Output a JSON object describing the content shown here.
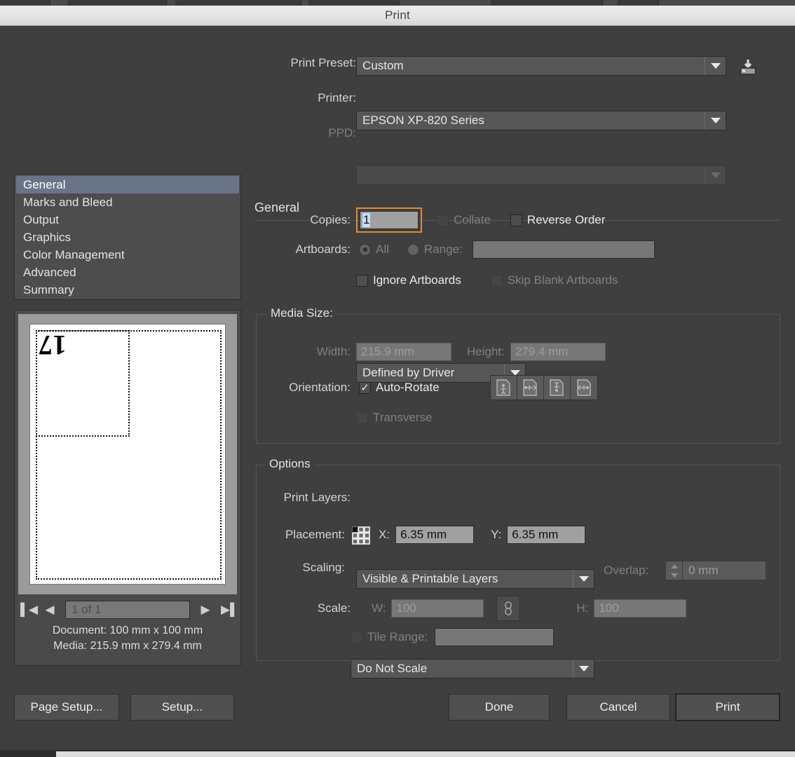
{
  "window": {
    "title": "Print"
  },
  "top_form": {
    "print_preset": {
      "label": "Print Preset:",
      "value": "Custom"
    },
    "printer": {
      "label": "Printer:",
      "value": "EPSON XP-820 Series"
    },
    "ppd": {
      "label": "PPD:",
      "value": ""
    },
    "save_preset_icon": "save-preset-icon"
  },
  "sidebar": {
    "items": [
      {
        "label": "General",
        "selected": true
      },
      {
        "label": "Marks and Bleed",
        "selected": false
      },
      {
        "label": "Output",
        "selected": false
      },
      {
        "label": "Graphics",
        "selected": false
      },
      {
        "label": "Color Management",
        "selected": false
      },
      {
        "label": "Advanced",
        "selected": false
      },
      {
        "label": "Summary",
        "selected": false
      }
    ]
  },
  "preview": {
    "artwork_glyph": "17",
    "page_indicator": "1 of 1",
    "document_line": "Document: 100 mm x 100 mm",
    "media_line": "Media: 215.9 mm x 279.4 mm",
    "nav": {
      "first": "first-page",
      "prev": "previous-page",
      "next": "next-page",
      "last": "last-page"
    }
  },
  "general": {
    "heading": "General",
    "copies": {
      "label": "Copies:",
      "value": "1"
    },
    "collate": {
      "label": "Collate",
      "checked": false,
      "enabled": false
    },
    "reverse_order": {
      "label": "Reverse Order",
      "checked": false,
      "enabled": true
    },
    "artboards": {
      "label": "Artboards:"
    },
    "artboards_all": {
      "label": "All",
      "selected": true,
      "enabled": false
    },
    "artboards_range": {
      "label": "Range:",
      "selected": false,
      "enabled": false,
      "value": ""
    },
    "ignore_artboards": {
      "label": "Ignore Artboards",
      "checked": false,
      "enabled": true
    },
    "skip_blank_artboards": {
      "label": "Skip Blank Artboards",
      "checked": false,
      "enabled": false
    }
  },
  "media_size": {
    "legend": "Media Size:",
    "value": "Defined by Driver",
    "width": {
      "label": "Width:",
      "value": "215.9 mm"
    },
    "height": {
      "label": "Height:",
      "value": "279.4 mm"
    },
    "orientation": {
      "label": "Orientation:"
    },
    "auto_rotate": {
      "label": "Auto-Rotate",
      "checked": true
    },
    "orientation_buttons": [
      "portrait-orientation-icon",
      "landscape-orientation-icon",
      "reverse-portrait-orientation-icon",
      "reverse-landscape-orientation-icon"
    ],
    "transverse": {
      "label": "Transverse",
      "checked": false,
      "enabled": false
    }
  },
  "options": {
    "legend": "Options",
    "print_layers": {
      "label": "Print Layers:",
      "value": "Visible & Printable Layers"
    },
    "placement": {
      "label": "Placement:",
      "proxy": "placement-proxy-icon",
      "x_label": "X:",
      "x_value": "6.35 mm",
      "y_label": "Y:",
      "y_value": "6.35 mm"
    },
    "scaling": {
      "label": "Scaling:",
      "value": "Do Not Scale"
    },
    "overlap": {
      "label": "Overlap:",
      "value": "0 mm",
      "enabled": false
    },
    "scale": {
      "label": "Scale:",
      "w_label": "W:",
      "w_value": "100",
      "h_label": "H:",
      "h_value": "100",
      "link_icon": "chain-link-icon",
      "enabled": false
    },
    "tile_range": {
      "label": "Tile Range:",
      "checked": false,
      "enabled": false,
      "value": ""
    }
  },
  "footer": {
    "page_setup": "Page Setup...",
    "setup": "Setup...",
    "done": "Done",
    "cancel": "Cancel",
    "print": "Print"
  },
  "colors": {
    "dialog_bg": "#3f3f3f",
    "titlebar_bg": "#e3e3e3",
    "selection_blue": "#6a7489",
    "focus_orange": "#e08c2e",
    "text_selection": "#c5ddf5"
  }
}
